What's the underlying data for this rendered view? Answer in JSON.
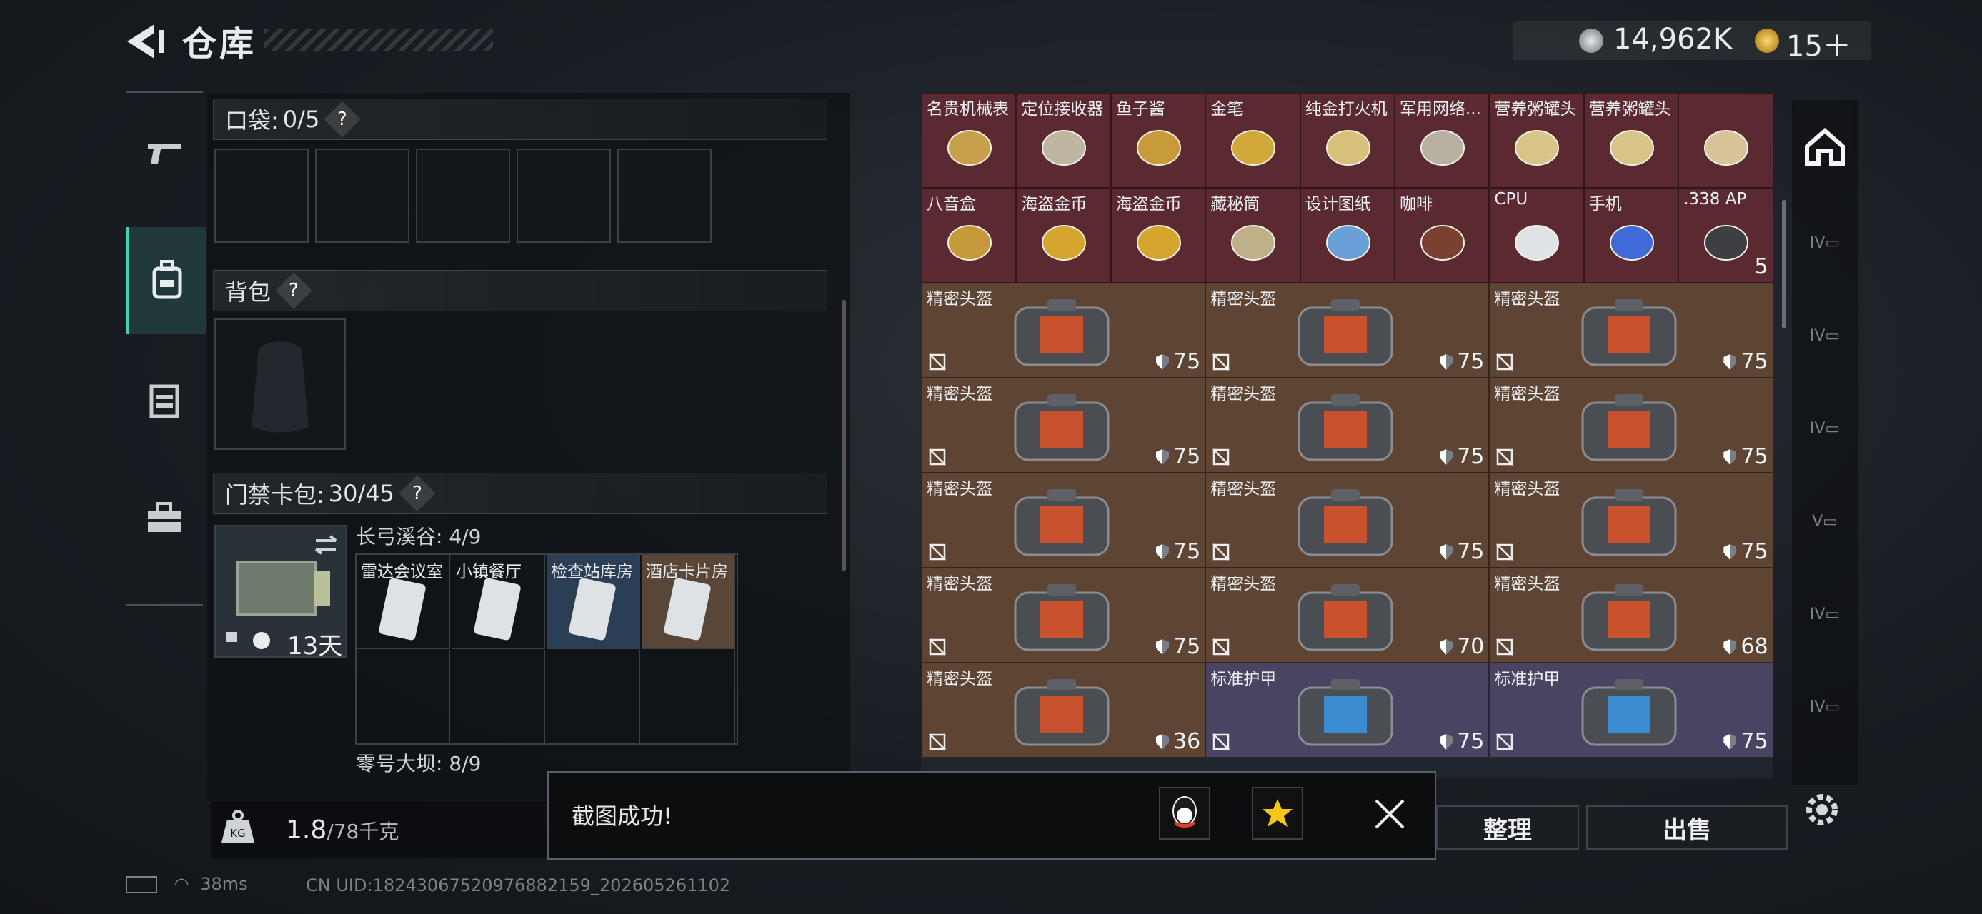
{
  "header": {
    "title": "仓库"
  },
  "currency": {
    "money": "14,962K",
    "tickets": "15＋"
  },
  "left_nav": {
    "items": [
      "weapon",
      "backpack",
      "rig",
      "toolbox"
    ],
    "active_index": 1
  },
  "pocket": {
    "label": "口袋:",
    "count": "0/5",
    "help": "?"
  },
  "backpack": {
    "label": "背包",
    "help": "?"
  },
  "card_pack": {
    "label": "门禁卡包:",
    "count": "30/45",
    "help": "?",
    "timer": "13天",
    "region1": {
      "name": "长弓溪谷:",
      "count": "4/9"
    },
    "region2": {
      "name": "零号大坝:",
      "count": "8/9"
    },
    "cards": [
      {
        "name": "雷达会议室",
        "bg": "#2a3038"
      },
      {
        "name": "小镇餐厅",
        "bg": "#2a3038"
      },
      {
        "name": "检查站库房",
        "bg": "#2a3f55"
      },
      {
        "name": "酒店卡片房",
        "bg": "#5a4636"
      }
    ]
  },
  "weight": {
    "current": "1.8",
    "max": "/78千克",
    "kg_label": "KG"
  },
  "inventory": {
    "row1": [
      {
        "name": "名贵机械表",
        "bg": "#5a2a30"
      },
      {
        "name": "定位接收器",
        "bg": "#5a2a30"
      },
      {
        "name": "鱼子酱",
        "bg": "#5a2a30"
      },
      {
        "name": "金笔",
        "bg": "#5a2a30"
      },
      {
        "name": "纯金打火机",
        "bg": "#5a2a30"
      },
      {
        "name": "军用网络...",
        "bg": "#5a2a30"
      },
      {
        "name": "营养粥罐头",
        "bg": "#5a2a30"
      },
      {
        "name": "营养粥罐头",
        "bg": "#5a2a30"
      },
      {
        "name": "",
        "bg": "#5a2a30"
      }
    ],
    "row2": [
      {
        "name": "八音盒",
        "bg": "#5a2a30"
      },
      {
        "name": "海盗金币",
        "bg": "#5a2a30"
      },
      {
        "name": "海盗金币",
        "bg": "#5a2a30"
      },
      {
        "name": "藏秘筒",
        "bg": "#5a2a30"
      },
      {
        "name": "设计图纸",
        "bg": "#5a2a30"
      },
      {
        "name": "咖啡",
        "bg": "#5a2a30"
      },
      {
        "name": "CPU",
        "bg": "#5a2a30"
      },
      {
        "name": "手机",
        "bg": "#5a2a30"
      },
      {
        "name": ".338 AP",
        "bg": "#5a2a30",
        "count": "5"
      }
    ],
    "helmet_rows": [
      [
        {
          "name": "精密头盔",
          "dur": "75"
        },
        {
          "name": "精密头盔",
          "dur": "75"
        },
        {
          "name": "精密头盔",
          "dur": "75"
        }
      ],
      [
        {
          "name": "精密头盔",
          "dur": "75"
        },
        {
          "name": "精密头盔",
          "dur": "75"
        },
        {
          "name": "精密头盔",
          "dur": "75"
        }
      ],
      [
        {
          "name": "精密头盔",
          "dur": "75"
        },
        {
          "name": "精密头盔",
          "dur": "75"
        },
        {
          "name": "精密头盔",
          "dur": "75"
        }
      ],
      [
        {
          "name": "精密头盔",
          "dur": "75"
        },
        {
          "name": "精密头盔",
          "dur": "70"
        },
        {
          "name": "精密头盔",
          "dur": "68"
        }
      ],
      [
        {
          "name": "精密头盔",
          "dur": "36"
        },
        {
          "name": "标准护甲",
          "dur": "75"
        },
        {
          "name": "标准护甲",
          "dur": "75"
        }
      ]
    ],
    "colors": {
      "brown": "#5e4433",
      "purple": "#4a4463",
      "red": "#5a2a30"
    }
  },
  "actions": {
    "sort": "整理",
    "sell": "出售"
  },
  "toast": {
    "message": "截图成功!"
  },
  "status": {
    "ping": "38ms",
    "uid": "CN UID:18243067520976882159_202605261102"
  }
}
